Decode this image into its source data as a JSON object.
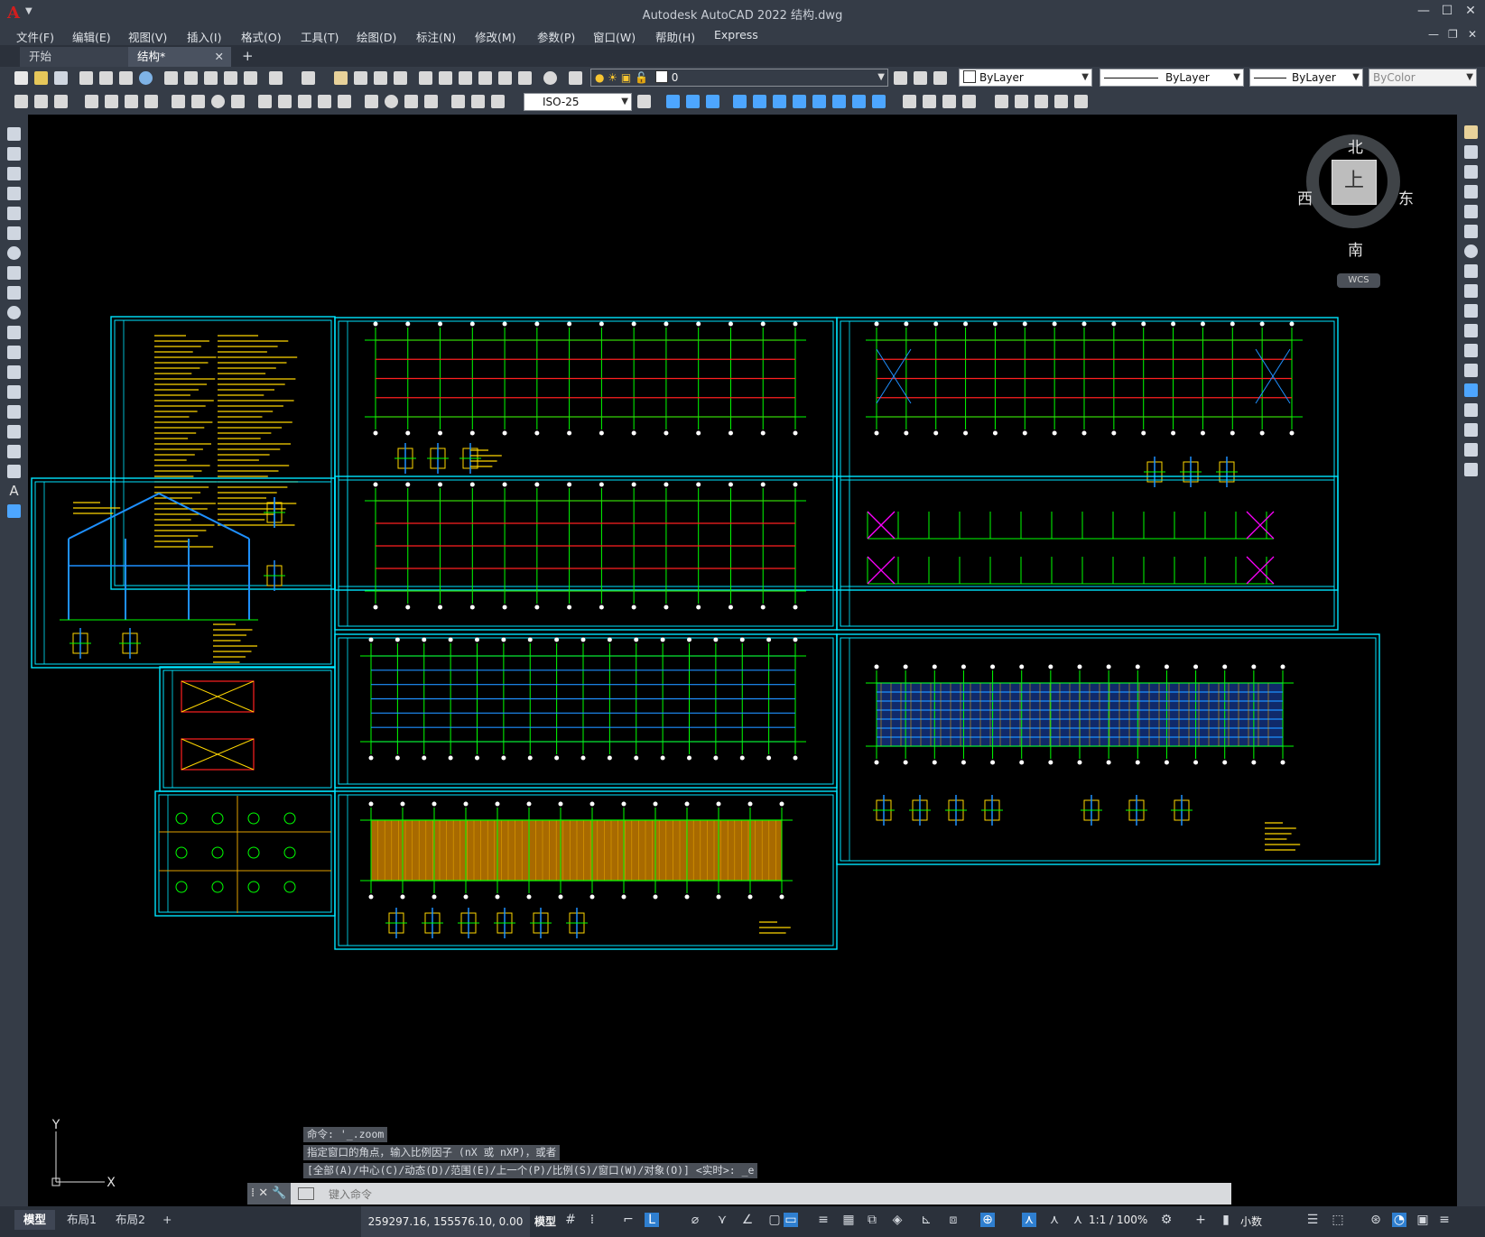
{
  "window": {
    "app_logo": "A",
    "title": "Autodesk AutoCAD 2022    结构.dwg",
    "minimize": "—",
    "restore": "☐",
    "close": "✕"
  },
  "menu": [
    "文件(F)",
    "编辑(E)",
    "视图(V)",
    "插入(I)",
    "格式(O)",
    "工具(T)",
    "绘图(D)",
    "标注(N)",
    "修改(M)",
    "参数(P)",
    "窗口(W)",
    "帮助(H)",
    "Express"
  ],
  "file_tabs": {
    "start": "开始",
    "active": "结构*",
    "close": "✕",
    "add": "+"
  },
  "toolbar": {
    "layer_value": "0",
    "color_value": "ByLayer",
    "linetype_value": "ByLayer",
    "lineweight_value": "ByLayer",
    "plotstyle_value": "ByColor",
    "dimstyle_value": "ISO-25"
  },
  "viewcube": {
    "north": "北",
    "south": "南",
    "east": "东",
    "west": "西",
    "face": "上",
    "wcs": "WCS"
  },
  "ucs": {
    "y": "Y",
    "x": "X"
  },
  "command": {
    "history": [
      "命令: '_.zoom",
      "指定窗口的角点，输入比例因子 (nX 或 nXP)，或者",
      "[全部(A)/中心(C)/动态(D)/范围(E)/上一个(P)/比例(S)/窗口(W)/对象(O)] <实时>: _e"
    ],
    "placeholder": "键入命令"
  },
  "layout_tabs": [
    "模型",
    "布局1",
    "布局2"
  ],
  "layout_add": "+",
  "status": {
    "coords": "259297.16, 155576.10, 0.00",
    "space": "模型",
    "scale": "1:1 / 100%",
    "units": "小数"
  },
  "colors": {
    "frame": "#00e5ff",
    "grid": "#00ff00",
    "member": "#ff2020",
    "steel": "#1e90ff",
    "note": "#ffd700",
    "brace": "#ff00ff",
    "purlin": "#e0a000"
  }
}
